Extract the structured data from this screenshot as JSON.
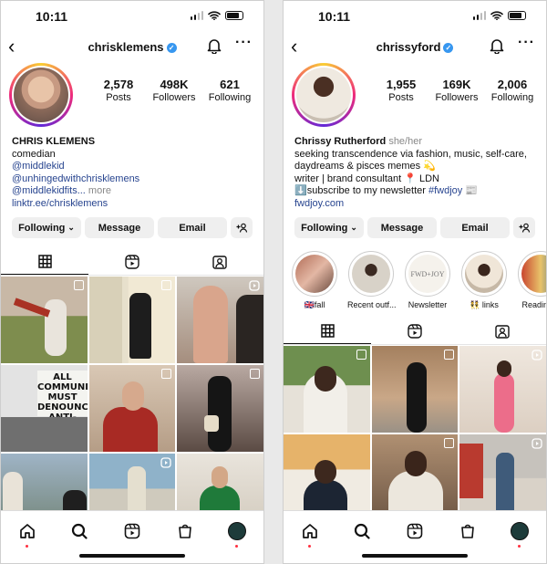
{
  "phones": {
    "left": {
      "status_time": "10:11",
      "username": "chrisklemens",
      "stats": [
        {
          "value": "2,578",
          "label": "Posts"
        },
        {
          "value": "498K",
          "label": "Followers"
        },
        {
          "value": "621",
          "label": "Following"
        }
      ],
      "bio": {
        "name": "CHRIS KLEMENS",
        "category": "comedian",
        "mention1": "@middlekid",
        "mention2": "@unhingedwithchrisklemens",
        "mention3": "@middlekidfits...",
        "more": " more",
        "link": "linktr.ee/chrisklemens"
      },
      "buttons": {
        "following": "Following",
        "message": "Message",
        "email": "Email"
      },
      "captions": {
        "all_communities": "ALL COMMUNITIES MUST DENOUNCE ANTI-SEMITISM"
      }
    },
    "right": {
      "status_time": "10:11",
      "username": "chrissyford",
      "stats": [
        {
          "value": "1,955",
          "label": "Posts"
        },
        {
          "value": "169K",
          "label": "Followers"
        },
        {
          "value": "2,006",
          "label": "Following"
        }
      ],
      "bio": {
        "name": "Chrissy Rutherford",
        "pronouns": "she/her",
        "line1": "seeking transcendence via fashion, music, self-care,",
        "line2": "daydreams & pisces memes 💫",
        "line3": "writer | brand consultant 📍 LDN",
        "line4_text": "⬇️subscribe to my newsletter ",
        "line4_tag": "#fwdjoy",
        "line4_emoji": " 📰",
        "link": "fwdjoy.com"
      },
      "buttons": {
        "following": "Following",
        "message": "Message",
        "email": "Email"
      },
      "highlights": [
        {
          "label": "🇬🇧fall"
        },
        {
          "label": "Recent outf..."
        },
        {
          "label": "Newsletter",
          "inner": "FWD+JOY"
        },
        {
          "label": "👯 links"
        },
        {
          "label": "Reading L"
        }
      ]
    }
  },
  "icons": {
    "back": "chevron-left-icon",
    "bell": "bell-icon",
    "more": "more-horizontal-icon",
    "grid": "grid-icon",
    "reels": "reels-icon",
    "tagged": "tagged-icon",
    "home": "home-icon",
    "search": "search-icon",
    "shop": "shop-bag-icon",
    "add_user": "add-user-icon"
  },
  "colors": {
    "verified": "#3797f0",
    "link": "#27448f",
    "notify_dot": "#ff3040"
  }
}
